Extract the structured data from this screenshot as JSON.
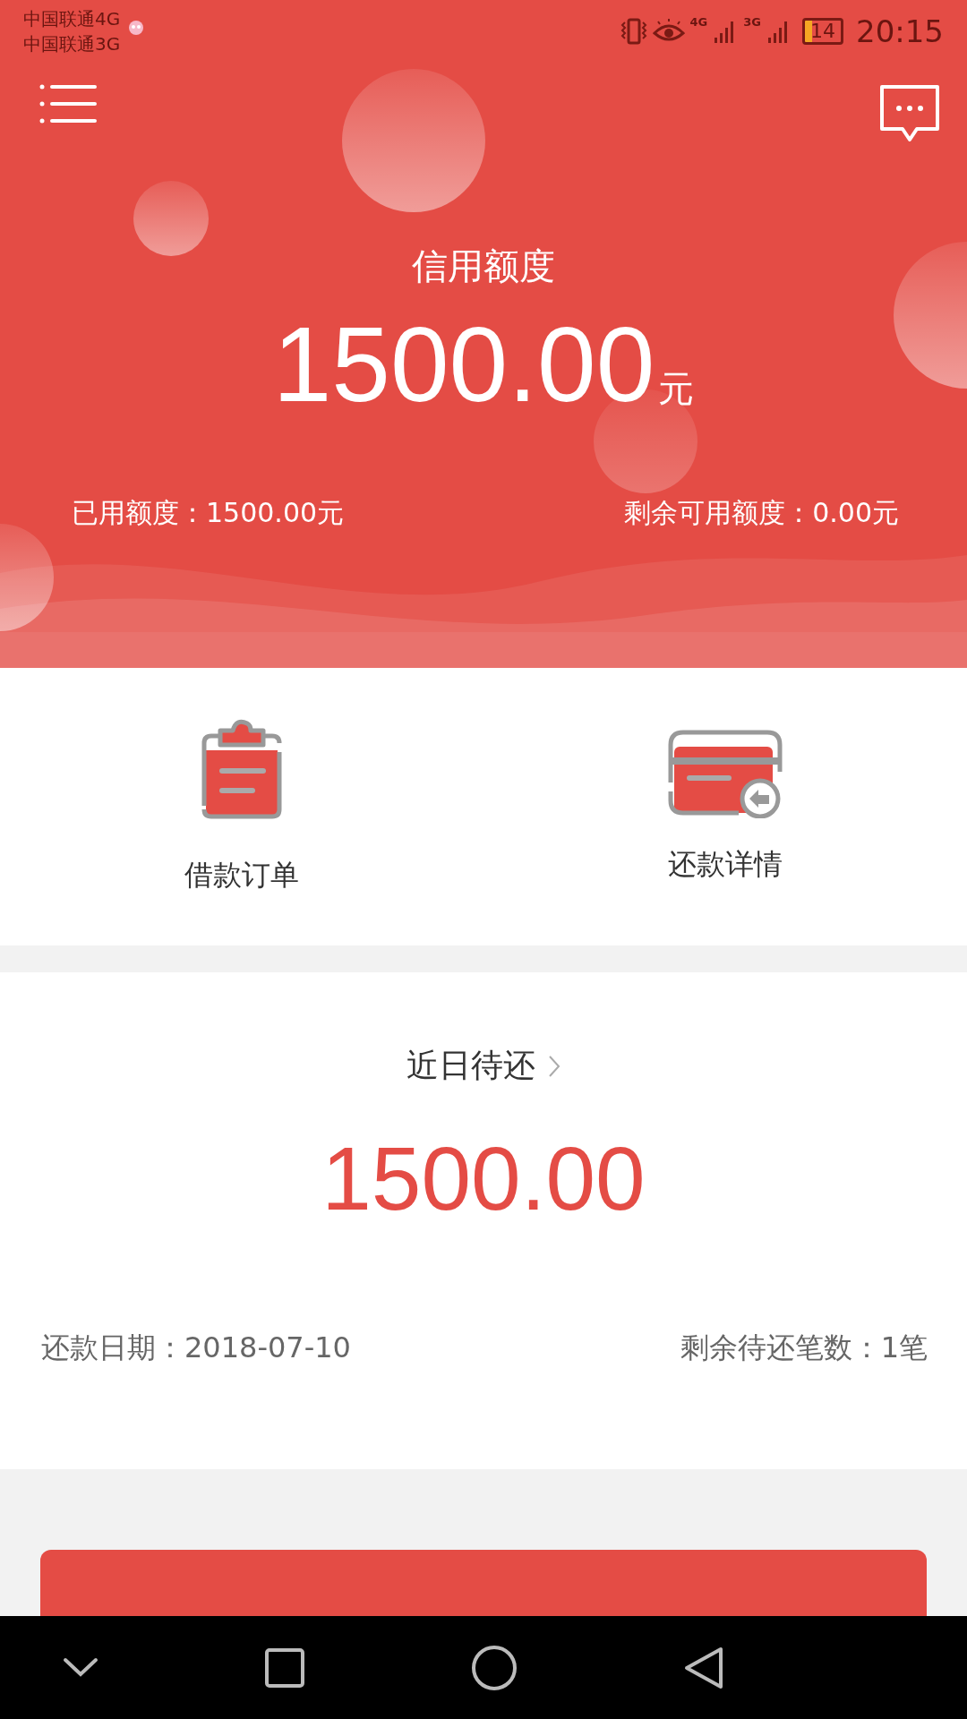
{
  "status_bar": {
    "carriers": [
      "中国联通4G",
      "中国联通3G"
    ],
    "network_4g": "4G",
    "network_3g": "3G",
    "battery": "14",
    "time": "20:15"
  },
  "credit": {
    "title": "信用额度",
    "amount": "1500.00",
    "unit": "元",
    "used": "已用额度：1500.00元",
    "remaining": "剩余可用额度：0.00元"
  },
  "shortcuts": [
    {
      "kind": "orders",
      "label": "借款订单"
    },
    {
      "kind": "repayment",
      "label": "还款详情"
    }
  ],
  "due": {
    "title": "近日待还",
    "amount": "1500.00",
    "date": "还款日期：2018-07-10",
    "count": "剩余待还笔数：1笔"
  }
}
